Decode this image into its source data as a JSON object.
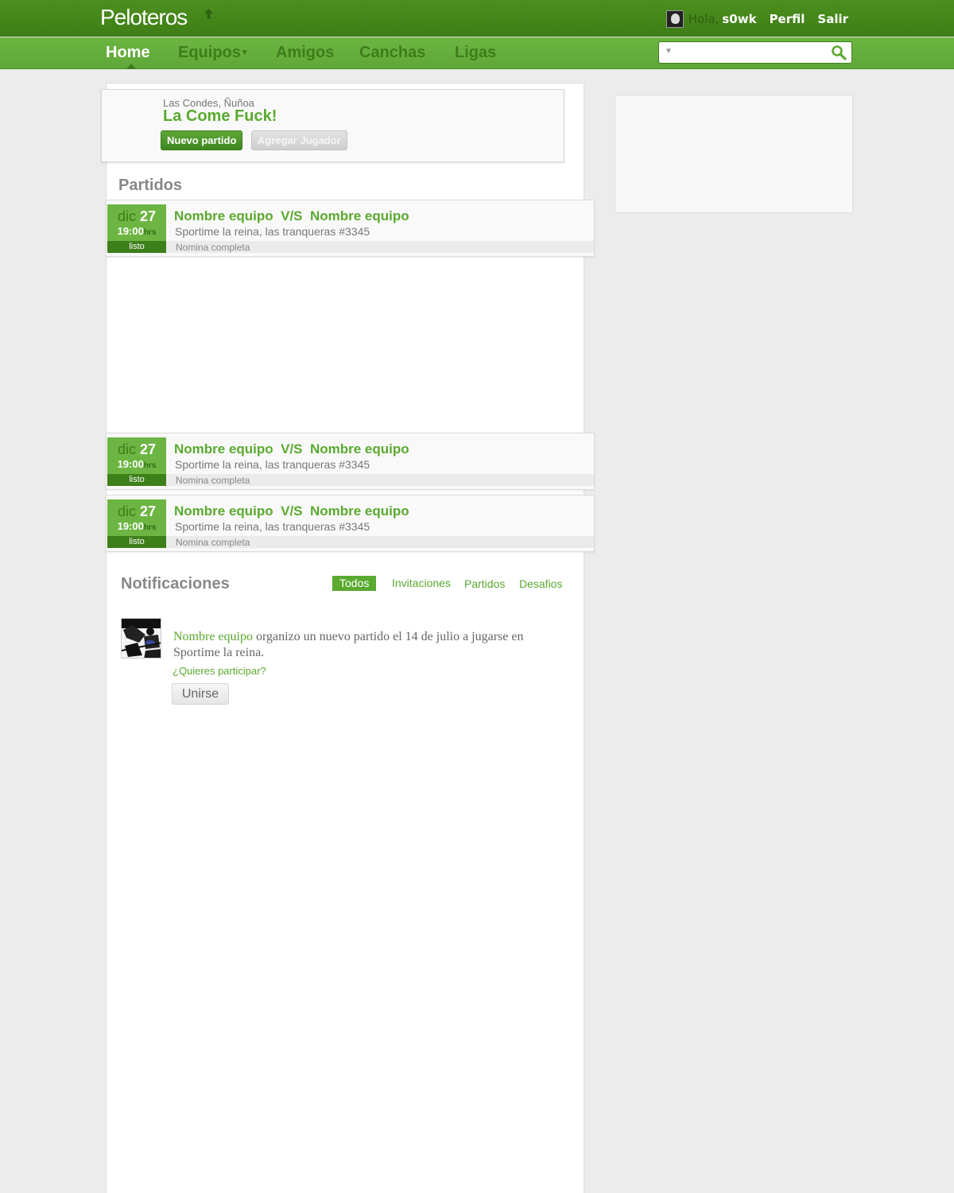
{
  "header": {
    "logo": "Peloteros",
    "greeting": "Hola,",
    "username": "s0wk",
    "profile_link": "Perfil",
    "logout_link": "Salir",
    "brand_color": "#3f7f17"
  },
  "nav": {
    "items": [
      {
        "label": "Home",
        "active": true
      },
      {
        "label": "Equipos",
        "has_dropdown": true
      },
      {
        "label": "Amigos"
      },
      {
        "label": "Canchas"
      },
      {
        "label": "Ligas"
      }
    ],
    "search": {
      "placeholder": "",
      "value": ""
    }
  },
  "team": {
    "location": "Las Condes, Ñuñoa",
    "name": "La Come Fuck!",
    "new_match_button": "Nuevo partido",
    "add_player_button": "Agregar Jugador"
  },
  "matches": {
    "title": "Partidos",
    "items": [
      {
        "month": "dic",
        "day": "27",
        "time": "19:00",
        "time_unit": "hrs",
        "status": "listo",
        "title": "Nombre equipo  V/S  Nombre equipo",
        "place": "Sportime la reina, las tranqueras #3345",
        "roster": "Nomina completa"
      },
      {
        "month": "dic",
        "day": "27",
        "time": "19:00",
        "time_unit": "hrs",
        "status": "listo",
        "title": "Nombre equipo  V/S  Nombre equipo",
        "place": "Sportime la reina, las tranqueras #3345",
        "roster": "Nomina completa"
      },
      {
        "month": "dic",
        "day": "27",
        "time": "19:00",
        "time_unit": "hrs",
        "status": "listo",
        "title": "Nombre equipo  V/S  Nombre equipo",
        "place": "Sportime la reina, las tranqueras #3345",
        "roster": "Nomina completa"
      }
    ]
  },
  "notifications": {
    "title": "Notificaciones",
    "filters": [
      "Todos",
      "Invitaciones",
      "Partidos",
      "Desafios"
    ],
    "active_filter": "Todos",
    "items": [
      {
        "team_link": "Nombre equipo",
        "message": " organizo un nuevo partido el 14 de julio a jugarse en Sportime la reina.",
        "question": "¿Quieres participar?",
        "join_button": "Unirse"
      }
    ]
  }
}
